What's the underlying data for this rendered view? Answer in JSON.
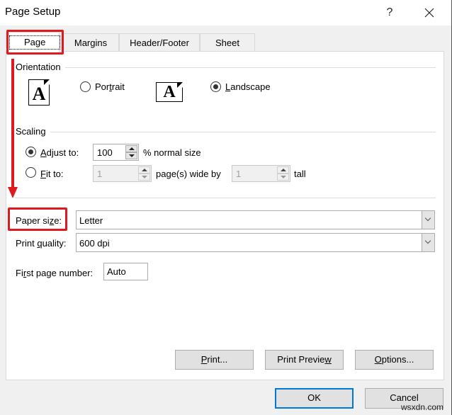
{
  "window": {
    "title": "Page Setup",
    "help_label": "?",
    "close_icon": "close-icon"
  },
  "tabs": [
    {
      "label": "Page",
      "active": true
    },
    {
      "label": "Margins",
      "active": false
    },
    {
      "label": "Header/Footer",
      "active": false
    },
    {
      "label": "Sheet",
      "active": false
    }
  ],
  "orientation": {
    "group_label": "Orientation",
    "portrait": {
      "pre": "Por",
      "u": "t",
      "post": "rait",
      "selected": false,
      "icon": "portrait-page-icon",
      "glyph": "A"
    },
    "landscape": {
      "pre": "",
      "u": "L",
      "post": "andscape",
      "selected": true,
      "icon": "landscape-page-icon",
      "glyph": "A"
    }
  },
  "scaling": {
    "group_label": "Scaling",
    "adjust_to": {
      "pre": "",
      "u": "A",
      "post": "djust to:",
      "selected": true,
      "value": "100",
      "suffix": "% normal size"
    },
    "fit_to": {
      "pre": "",
      "u": "F",
      "post": "it to:",
      "selected": false,
      "wide_value": "1",
      "wide_suffix": "page(s) wide by",
      "tall_value": "1",
      "tall_suffix": "tall"
    }
  },
  "paper_size": {
    "pre": "Paper si",
    "u": "z",
    "post": "e:",
    "value": "Letter"
  },
  "print_quality": {
    "pre": "Print ",
    "u": "q",
    "post": "uality:",
    "value": "600 dpi"
  },
  "first_page_number": {
    "pre": "Fi",
    "u": "r",
    "post": "st page number:",
    "value": "Auto"
  },
  "panel_buttons": {
    "print": {
      "pre": "",
      "u": "P",
      "post": "rint..."
    },
    "print_preview": {
      "pre": "Print Previe",
      "u": "w",
      "post": ""
    },
    "options": {
      "pre": "",
      "u": "O",
      "post": "ptions..."
    }
  },
  "footer_buttons": {
    "ok": "OK",
    "cancel": "Cancel"
  },
  "annotation": {
    "color": "#e0191f"
  },
  "watermark": "wsxdn.com"
}
